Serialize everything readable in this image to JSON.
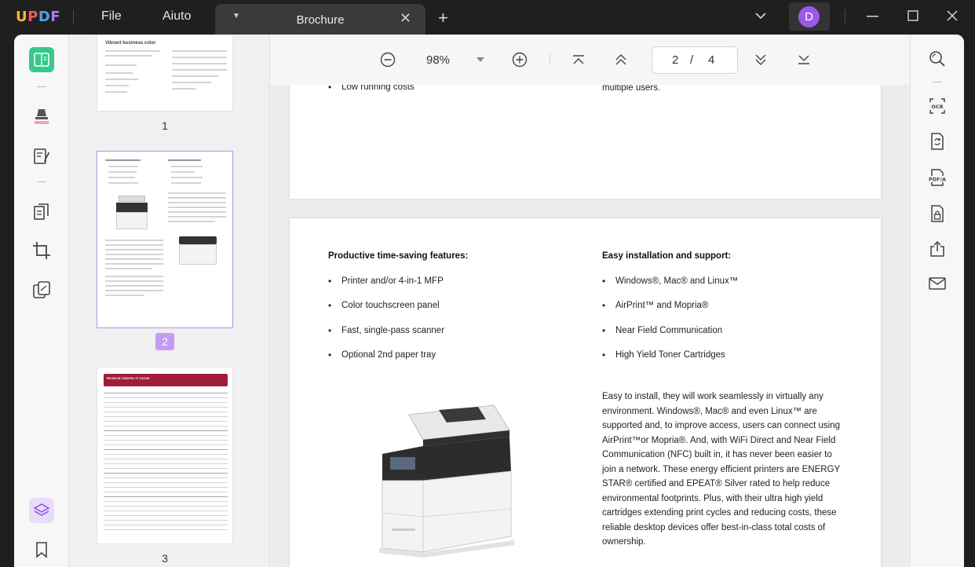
{
  "app": {
    "logo": [
      "U",
      "P",
      "D",
      "F"
    ],
    "menu": {
      "file": "File",
      "aiuto": "Aiuto"
    },
    "tab": {
      "title": "Brochure"
    },
    "user_initial": "D",
    "accent": "#9b59e8"
  },
  "toolbar": {
    "zoom": "98%",
    "current_page": "2",
    "page_separator": "/",
    "total_pages": "4"
  },
  "thumbnails": [
    {
      "number": "1",
      "heading": "Vibrant business color"
    },
    {
      "number": "2"
    },
    {
      "number": "3",
      "heading": "RICOH M C251FW / P C311W"
    }
  ],
  "page1_fragment": {
    "bullet": "Low running costs",
    "right_text": "these productive desktop printers can be shared by multiple users."
  },
  "page2": {
    "left_heading": "Productive time-saving features:",
    "left_items": [
      "Printer and/or 4-in-1 MFP",
      "Color touchscreen panel",
      "Fast, single-pass scanner",
      "Optional 2nd paper tray"
    ],
    "right_heading": "Easy installation and support:",
    "right_items": [
      "Windows®, Mac® and Linux™",
      "AirPrint™ and Mopria®",
      "Near Field Communication",
      "High Yield Toner Cartridges"
    ],
    "paragraph_lines": [
      "Easy to install, they will work seamlessly in virtually any",
      "environment. Windows®, Mac® and even Linux™ are",
      "supported and, to improve access, users can connect using",
      "AirPrint™or Mopria®. And, with WiFi Direct and Near Field",
      "Communication (NFC) built in, it has never been easier to",
      "join a network. These energy efficient printers are ENERGY",
      "STAR® certified and EPEAT® Silver rated to help reduce",
      "environmental footprints. Plus, with their ultra high yield",
      "cartridges extending print cycles and reducing costs, these",
      "reliable desktop devices offer best-in-class total costs of",
      "ownership."
    ]
  }
}
